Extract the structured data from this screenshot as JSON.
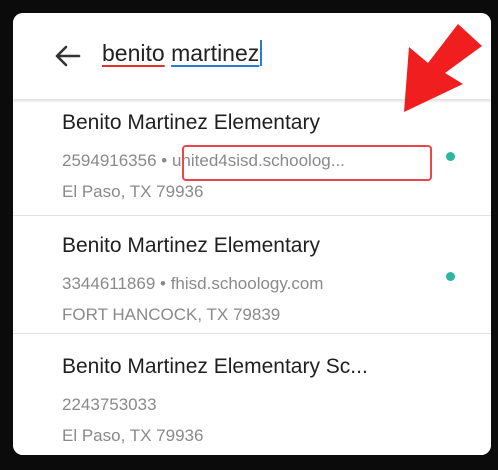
{
  "search": {
    "query_part1": "benito",
    "query_part2": "martinez"
  },
  "results": [
    {
      "title": "Benito Martinez Elementary",
      "code": "2594916356",
      "separator": " • ",
      "domain": "united4sisd.schoolog...",
      "location": "El Paso, TX 79936",
      "status_dot": true
    },
    {
      "title": "Benito Martinez Elementary",
      "code": "3344611869",
      "separator": " • ",
      "domain": "fhisd.schoology.com",
      "location": "FORT HANCOCK, TX 79839",
      "status_dot": true
    },
    {
      "title": "Benito Martinez Elementary Sc...",
      "code": "2243753033",
      "location": "El Paso, TX 79936",
      "status_dot": false
    }
  ],
  "annotation": {
    "arrow_color": "#f01e1e",
    "box_color": "#e8484a"
  },
  "colors": {
    "status_dot": "#2cb5a0",
    "accent": "#2a7bd6"
  },
  "icons": {
    "back": "back-arrow-icon",
    "status": "status-dot-icon",
    "annotation": "red-arrow-icon"
  }
}
